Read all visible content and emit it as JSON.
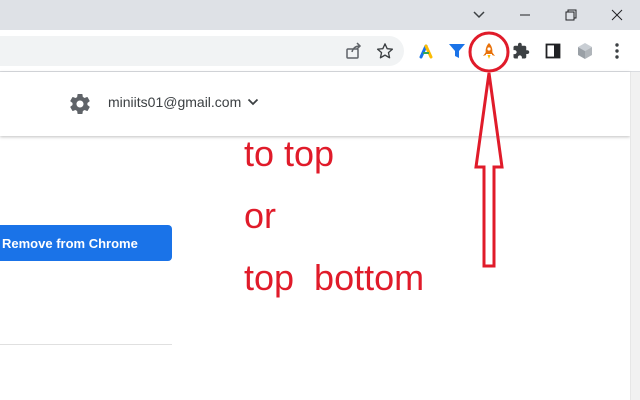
{
  "account": {
    "email": "miniits01@gmail.com"
  },
  "content": {
    "remove_button_label": "Remove from Chrome"
  },
  "annotation": {
    "line1": "to top",
    "line2": "or",
    "line3": "top  bottom"
  },
  "colors": {
    "annotation": "#e01b2a",
    "primary_button": "#1a73e8",
    "rocket_icon": "#e8710a",
    "filter_icon": "#1a73e8"
  },
  "icons": {
    "titlebar": [
      "chevron-down-icon",
      "minimize-icon",
      "restore-icon",
      "close-icon"
    ],
    "toolbar": [
      "share-icon",
      "star-icon",
      "color-extension-icon",
      "filter-extension-icon",
      "rocket-extension-icon",
      "puzzle-icon",
      "side-panel-icon",
      "cube-extension-icon",
      "more-vert-icon"
    ]
  }
}
